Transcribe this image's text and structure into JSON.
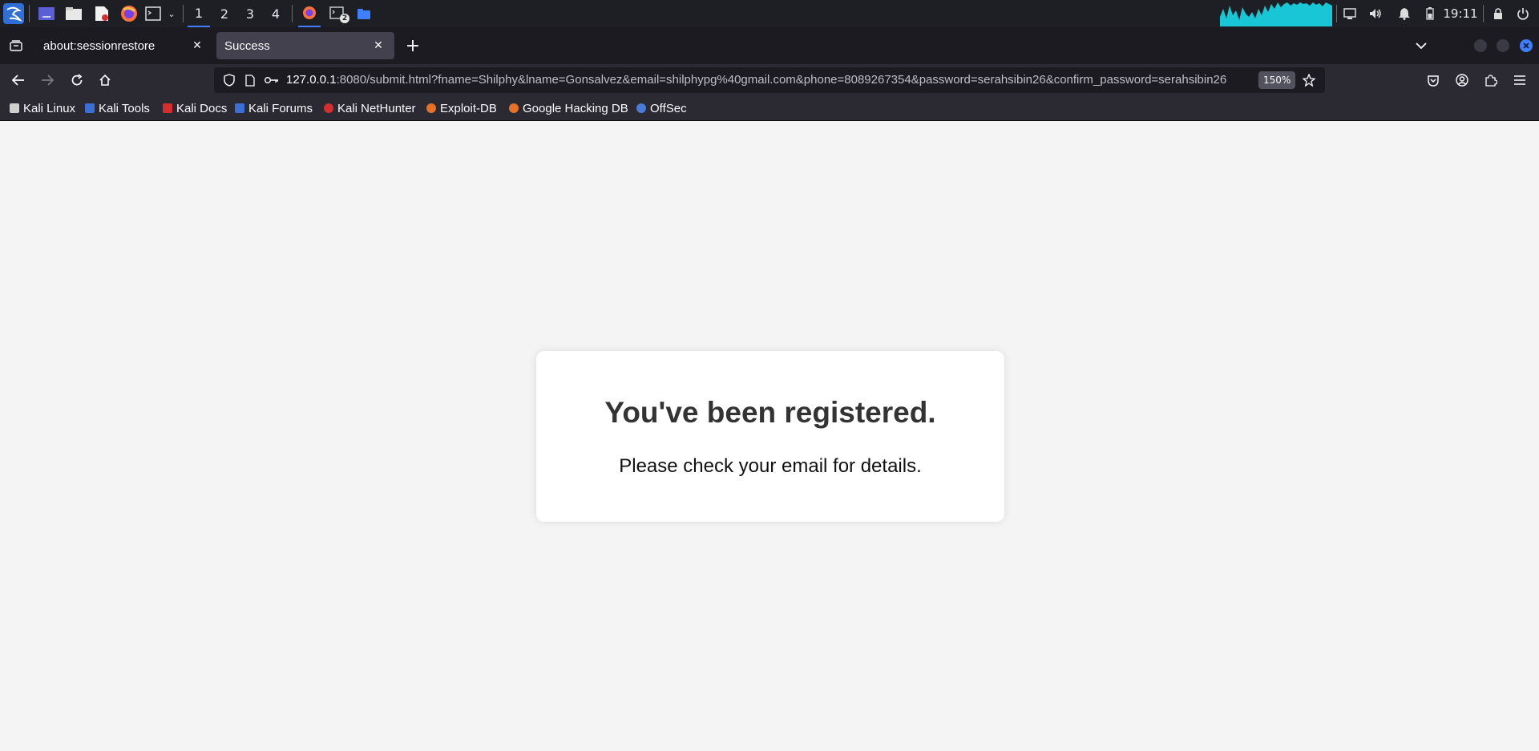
{
  "taskbar": {
    "workspaces": [
      "1",
      "2",
      "3",
      "4"
    ],
    "active_workspace": "1",
    "clock": "19:11",
    "terminal_badge": "2"
  },
  "tabs": [
    {
      "title": "about:sessionrestore",
      "selected": false
    },
    {
      "title": "Success",
      "selected": true
    }
  ],
  "navbar": {
    "url_host": "127.0.0.1",
    "url_rest": ":8080/submit.html?fname=Shilphy&lname=Gonsalvez&email=shilphypg%40gmail.com&phone=8089267354&password=serahsibin26&confirm_password=serahsibin26",
    "zoom": "150%"
  },
  "bookmarks": [
    {
      "label": "Kali Linux",
      "color": "#cfcfcf"
    },
    {
      "label": "Kali Tools",
      "color": "#3b6fd6"
    },
    {
      "label": "Kali Docs",
      "color": "#d32f2f"
    },
    {
      "label": "Kali Forums",
      "color": "#3b6fd6"
    },
    {
      "label": "Kali NetHunter",
      "color": "#d32f2f"
    },
    {
      "label": "Exploit-DB",
      "color": "#e8712a"
    },
    {
      "label": "Google Hacking DB",
      "color": "#e8712a"
    },
    {
      "label": "OffSec",
      "color": "#4a7bd6"
    }
  ],
  "page": {
    "heading": "You've been registered.",
    "message": "Please check your email for details."
  },
  "colors": {
    "accent": "#3d7fff",
    "page_bg": "#f4f4f4",
    "card_bg": "#ffffff"
  }
}
